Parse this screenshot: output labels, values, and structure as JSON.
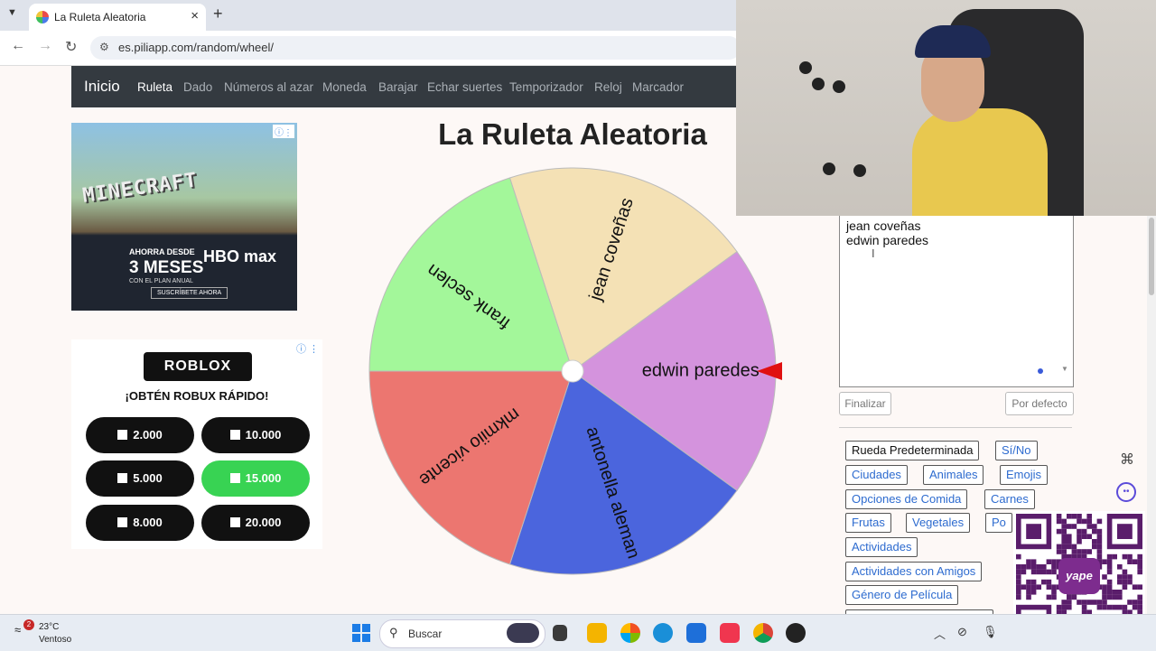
{
  "browser": {
    "tab_title": "La Ruleta Aleatoria",
    "url": "es.piliapp.com/random/wheel/",
    "icons": [
      "tab-menu-icon",
      "close-icon",
      "plus-icon",
      "back-icon",
      "forward-icon",
      "reload-icon",
      "site-info-icon"
    ]
  },
  "nav": {
    "brand": "Inicio",
    "links": [
      "Ruleta",
      "Dado",
      "Números al azar",
      "Moneda",
      "Barajar",
      "Echar suertes",
      "Temporizador",
      "Reloj",
      "Marcador"
    ],
    "active": "Ruleta"
  },
  "ad1": {
    "brand_text": "MINECRAFT",
    "line1": "AHORRA DESDE",
    "line2": "3 MESES",
    "line3": "CON EL PLAN ANUAL",
    "logo": "HBO max",
    "cta": "SUSCRÍBETE AHORA"
  },
  "ad2": {
    "logo": "ROBLOX",
    "headline": "¡OBTÉN ROBUX RÁPIDO!",
    "options": [
      "2.000",
      "10.000",
      "5.000",
      "15.000",
      "8.000",
      "20.000"
    ],
    "highlighted": "15.000"
  },
  "page": {
    "title": "La Ruleta Aleatoria"
  },
  "wheel": {
    "segments": [
      {
        "label": "jean coveñas",
        "color": "#f4e1b5"
      },
      {
        "label": "edwin paredes",
        "color": "#d493dd"
      },
      {
        "label": "antonella aleman",
        "color": "#4b65dd"
      },
      {
        "label": "mkmiio vicente",
        "color": "#ec7670"
      },
      {
        "label": "frank seclen",
        "color": "#a3f79a"
      }
    ],
    "pointer_color": "#e01010"
  },
  "names_box": {
    "lines": [
      "jean coveñas",
      "edwin paredes"
    ]
  },
  "buttons": {
    "finish": "Finalizar",
    "default": "Por defecto"
  },
  "presets": [
    "Rueda Predeterminada",
    "Sí/No",
    "Ciudades",
    "Animales",
    "Emojis",
    "Opciones de Comida",
    "Carnes",
    "Frutas",
    "Vegetales",
    "Po",
    "Actividades",
    "Actividades con Amigos",
    "Género de Película"
  ],
  "qr": {
    "logo_text": "yape"
  },
  "taskbar": {
    "notification_count": "2",
    "temperature": "23°C",
    "condition": "Ventoso",
    "search_placeholder": "Buscar"
  }
}
